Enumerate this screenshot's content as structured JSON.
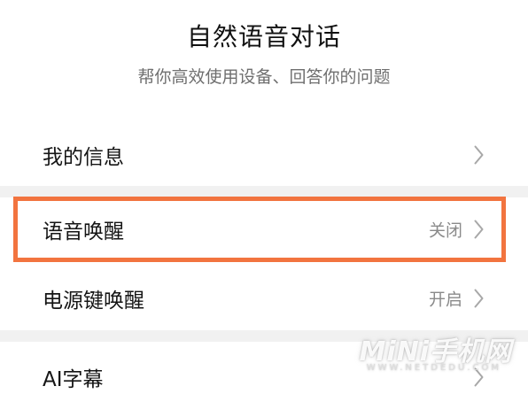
{
  "header": {
    "title": "自然语音对话",
    "subtitle": "帮你高效使用设备、回答你的问题"
  },
  "rows": [
    {
      "label": "我的信息",
      "value": "",
      "icon": "chevron-right-icon"
    },
    {
      "label": "语音唤醒",
      "value": "关闭",
      "icon": "chevron-right-icon"
    },
    {
      "label": "电源键唤醒",
      "value": "开启",
      "icon": "chevron-right-icon"
    },
    {
      "label": "AI字幕",
      "value": "",
      "icon": "chevron-right-icon"
    }
  ],
  "highlight": {
    "target": "语音唤醒",
    "color": "#f2743f"
  },
  "watermark": {
    "text": "MiNi手机网",
    "sub": "WWW.NETDEDU.COM"
  },
  "colors": {
    "divider": "#f1f1f1",
    "value_text": "#8a8a8a"
  }
}
